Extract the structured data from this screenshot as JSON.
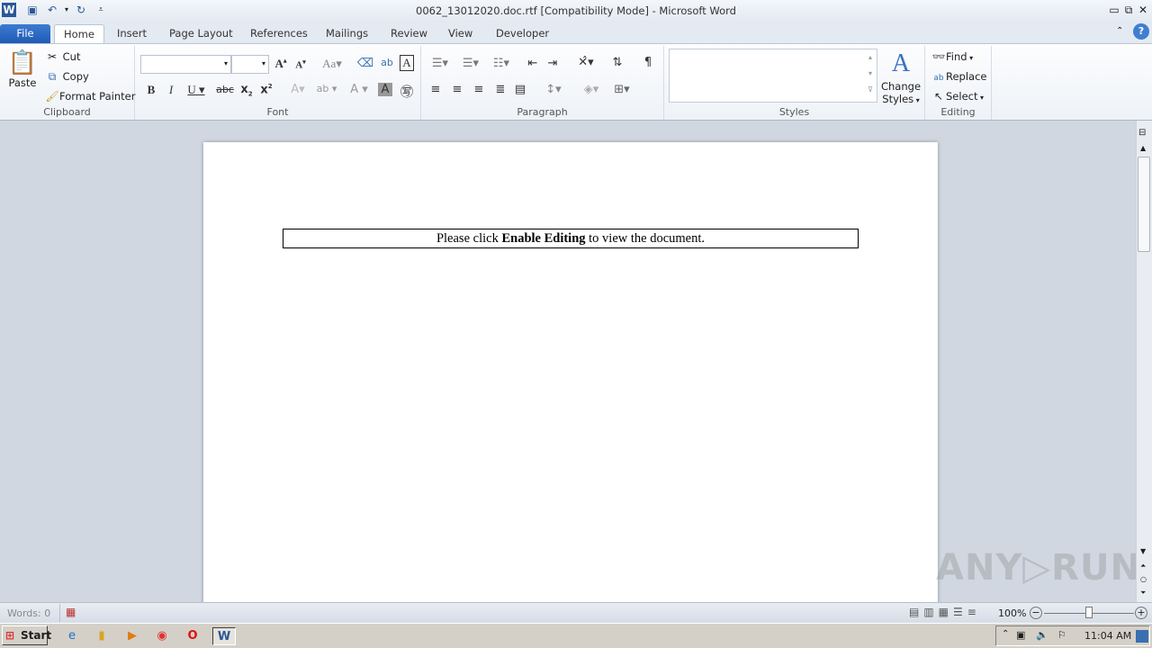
{
  "window": {
    "title": "0062_13012020.doc.rtf [Compatibility Mode]  -  Microsoft Word"
  },
  "tabs": [
    {
      "label": "File"
    },
    {
      "label": "Home"
    },
    {
      "label": "Insert"
    },
    {
      "label": "Page Layout"
    },
    {
      "label": "References"
    },
    {
      "label": "Mailings"
    },
    {
      "label": "Review"
    },
    {
      "label": "View"
    },
    {
      "label": "Developer"
    }
  ],
  "ribbon": {
    "clipboard": {
      "label": "Clipboard",
      "paste": "Paste",
      "cut": "Cut",
      "copy": "Copy",
      "format_painter": "Format Painter"
    },
    "font": {
      "label": "Font",
      "font_name": "",
      "font_size": ""
    },
    "paragraph": {
      "label": "Paragraph"
    },
    "styles": {
      "label": "Styles",
      "change_styles_1": "Change",
      "change_styles_2": "Styles"
    },
    "editing": {
      "label": "Editing",
      "find": "Find",
      "replace": "Replace",
      "select": "Select"
    }
  },
  "document": {
    "pre": "Please click ",
    "bold": "Enable Editing",
    "post": " to view the document."
  },
  "status": {
    "words": "Words: 0",
    "zoom": "100%",
    "zoom_level": 100
  },
  "taskbar": {
    "start": "Start",
    "clock": "11:04 AM"
  },
  "watermark": "ANY▷RUN"
}
